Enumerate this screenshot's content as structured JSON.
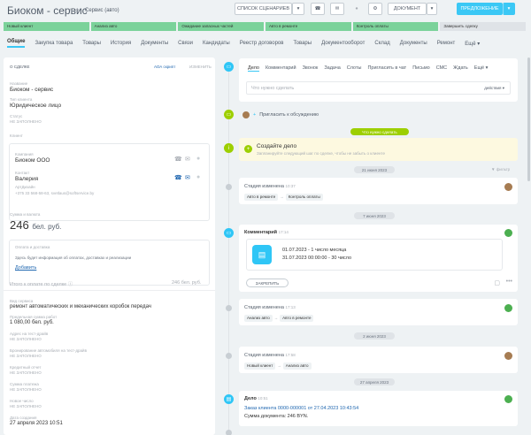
{
  "header": {
    "title": "Биоком - сервис",
    "deal_type": "Сервис (авто)",
    "scenarios_label": "СПИСОК СЦЕНАРИЕВ",
    "document_label": "ДОКУМЕНТ",
    "offer_label": "ПРЕДЛОЖЕНИЕ",
    "accent_color": "#3bc8f5"
  },
  "stages": [
    {
      "label": "Новый клиент",
      "color": "#7bd29a"
    },
    {
      "label": "Анализ авто",
      "color": "#7bd29a"
    },
    {
      "label": "Ожидание запасных частей",
      "color": "#7bd29a"
    },
    {
      "label": "Авто в ремонте",
      "color": "#7bd29a"
    },
    {
      "label": "Контроль оплаты",
      "color": "#7bd29a"
    },
    {
      "label": "Завершить сделку",
      "color": "#dfe3e7"
    }
  ],
  "tabs": [
    "Общие",
    "Закупка товара",
    "Товары",
    "История",
    "Документы",
    "Связи",
    "Кандидаты",
    "Реестр договоров",
    "Товары",
    "Документооборот",
    "Склад",
    "Документы",
    "Ремонт",
    "Ещё"
  ],
  "left": {
    "section_title": "О СДЕЛКЕ",
    "add_label": "АОА скрипт",
    "edit_label": "ИЗМЕНИТЬ",
    "name_label": "Название",
    "name_value": "Биоком - сервис",
    "client_type_label": "Тип клиента",
    "client_type_value": "Юридическое лицо",
    "status_label": "Статус",
    "status_value": "не заполнено",
    "client_label": "Клиент",
    "company_label": "Компания",
    "company_value": "Биоком ООО",
    "contact_label": "Контакт",
    "contact_value": "Валерия",
    "contact_role": "АртДизайн",
    "contact_details": "+375 33 568-58-63, svetlaus@softservice.by",
    "amount_label": "Сумма и валюта",
    "amount_value": "246",
    "amount_currency": "бел. руб.",
    "payment_title": "Оплата и доставка",
    "payment_hint": "Здесь будет информация об оплатах, доставках и реализации",
    "payment_add": "Добавить",
    "payment_total_label": "Итого к оплате по сделке",
    "payment_total_value": "246 бел. руб.",
    "service_label": "Вид сервиса",
    "service_value": "ремонт автоматических и механических коробок передач",
    "prelim_label": "Предельная сумма работ",
    "prelim_value": "1 080,00 бел. руб.",
    "address_label": "Адрес на тест-драйв",
    "address_value": "не заполнено",
    "booking_label": "Бронирование автомобиля на тест-драйв",
    "booking_value": "не заполнено",
    "credit_label": "Кредитный отчет",
    "credit_value": "не заполнено",
    "payment_sum_label": "Сумма платежа",
    "payment_sum_value": "не заполнено",
    "new_label": "Новое число",
    "new_value": "не заполнено",
    "created_label": "Дата создания",
    "created_value": "27 апреля 2023 10:51"
  },
  "composer": {
    "tabs": [
      "Дело",
      "Комментарий",
      "Звонок",
      "Задача",
      "Слоты",
      "Пригласить в чат",
      "Письмо",
      "СМС",
      "Ждать",
      "Ещё"
    ],
    "placeholder": "Что нужно сделать",
    "actions_label": "действия"
  },
  "timeline": {
    "invite_text": "Пригласить к обсуждению",
    "todo_badge": "Что нужно сделать",
    "create_title": "Создайте дело",
    "create_hint": "Запланируйте следующий шаг по сделке, чтобы не забыть о клиенте",
    "date1": "21 июня 2023",
    "filter_label": "фильтр",
    "stage_change_label": "Стадия изменена",
    "e1_time": "10:37",
    "e1_from": "Авто в ремонте",
    "e1_to": "Контроль оплаты",
    "date2": "7 июня 2023",
    "comment_label": "Комментарий",
    "comment_time": "17:14",
    "comment_line1": "01.07.2023 - 1 число месяца",
    "comment_line2": "31.07.2023 00:00:00 - 30 число",
    "pin_label": "ЗАКРЕПИТЬ",
    "e3_time": "17:13",
    "e3_from": "Анализ авто",
    "e3_to": "Авто в ремонте",
    "date3": "2 июня 2023",
    "e4_time": "17:58",
    "e4_from": "Новый клиент",
    "e4_to": "Анализ авто",
    "date4": "27 апреля 2023",
    "doc_label": "Дело",
    "doc_time": "10:51",
    "doc_line1": "Заказ клиента 0000-000001 от 27.04.2023 10:43:54",
    "doc_line2": "Сумма документа: 246 BYN."
  }
}
